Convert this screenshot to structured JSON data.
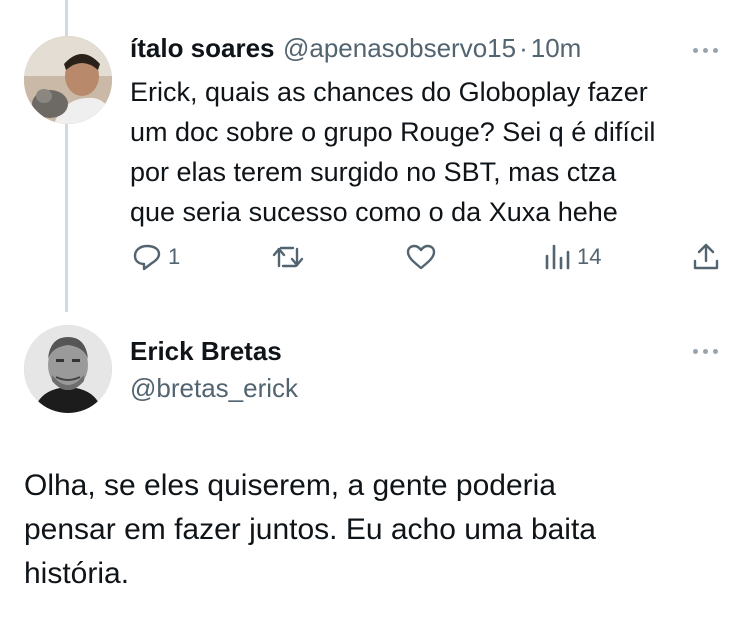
{
  "tweet": {
    "author_name": "ítalo soares",
    "author_handle": "@apenasobservo15",
    "separator": "·",
    "time": "10m",
    "text_lines": [
      "Erick, quais as chances do Globoplay fazer",
      "um doc sobre o grupo Rouge? Sei q é difícil",
      "por elas terem surgido no SBT, mas ctza",
      "que seria sucesso como o da Xuxa hehe"
    ],
    "actions": {
      "reply_count": "1",
      "views_count": "14"
    }
  },
  "reply": {
    "author_name": "Erick Bretas",
    "author_handle": "@bretas_erick",
    "text_lines": [
      "Olha, se eles quiserem, a gente poderia",
      "pensar em fazer juntos. Eu acho uma baita",
      "história."
    ]
  },
  "icons": {
    "reply": "reply-icon",
    "retweet": "retweet-icon",
    "like": "heart-icon",
    "views": "views-icon",
    "share": "share-icon",
    "more": "more-icon"
  },
  "colors": {
    "text": "#0f1419",
    "muted": "#536471",
    "thread_line": "#cfd9de"
  }
}
